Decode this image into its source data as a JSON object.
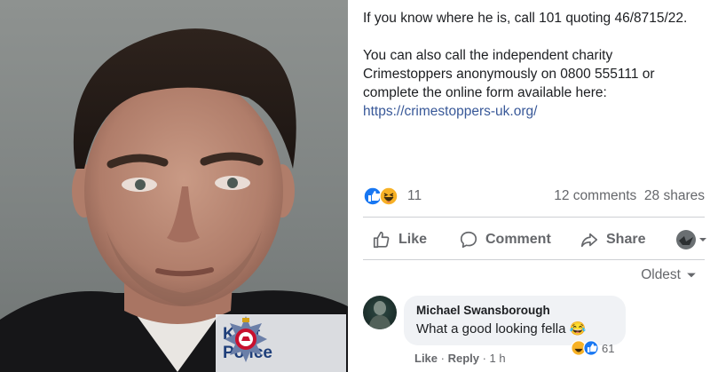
{
  "post": {
    "paragraph1": "If you know where he is, call 101 quoting 46/8715/22.",
    "paragraph2_prefix": "You can also call the independent charity Crimestoppers anonymously on 0800 555111 or complete the online form available here: ",
    "link": "https://crimestoppers-uk.org/",
    "reaction_count": "11",
    "comments_count": "12 comments",
    "shares_count": "28 shares"
  },
  "actions": {
    "like": "Like",
    "comment": "Comment",
    "share": "Share"
  },
  "sort": {
    "label": "Oldest"
  },
  "badge": {
    "line1": "Kent",
    "line2": "Police"
  },
  "comment": {
    "author": "Michael Swansborough",
    "text": "What a good looking fella 😂",
    "react_count": "61",
    "like": "Like",
    "sep": " · ",
    "reply": "Reply",
    "time": "1 h"
  },
  "colors": {
    "link": "#385898",
    "like_blue": "#1877f2",
    "haha_yellow": "#f7b125",
    "muted": "#65676b"
  },
  "icons": [
    "like-reaction-icon",
    "haha-reaction-icon",
    "thumbs-up-icon",
    "comment-bubble-icon",
    "share-arrow-icon",
    "profile-switch-icon",
    "dropdown-arrow-icon",
    "kent-police-crest-icon"
  ]
}
